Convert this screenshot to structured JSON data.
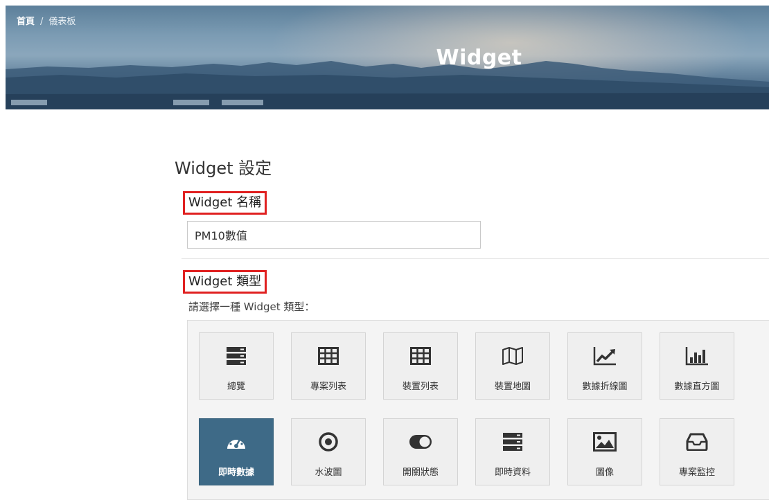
{
  "breadcrumb": {
    "home": "首頁",
    "separator": "/",
    "current": "儀表板"
  },
  "banner": {
    "title": "Widget"
  },
  "page": {
    "title": "Widget 設定"
  },
  "name_section": {
    "label": "Widget 名稱",
    "input_value": "PM10數值"
  },
  "type_section": {
    "label": "Widget 類型",
    "hint": "請選擇一種 Widget 類型："
  },
  "widget_types": [
    {
      "label": "總覽",
      "icon": "server-icon"
    },
    {
      "label": "專案列表",
      "icon": "table-icon"
    },
    {
      "label": "裝置列表",
      "icon": "table-icon"
    },
    {
      "label": "裝置地圖",
      "icon": "map-icon"
    },
    {
      "label": "數據折線圖",
      "icon": "line-chart-icon"
    },
    {
      "label": "數據直方圖",
      "icon": "bar-chart-icon"
    },
    {
      "label": "即時數據",
      "icon": "dashboard-gauge-icon",
      "selected": true
    },
    {
      "label": "水波圖",
      "icon": "target-icon"
    },
    {
      "label": "開關狀態",
      "icon": "toggle-icon"
    },
    {
      "label": "即時資料",
      "icon": "server-icon"
    },
    {
      "label": "圖像",
      "icon": "image-icon"
    },
    {
      "label": "專案監控",
      "icon": "inbox-icon"
    }
  ],
  "colors": {
    "selected_tile": "#3e6a87",
    "highlight_border": "#e02020",
    "icon": "#333333"
  }
}
